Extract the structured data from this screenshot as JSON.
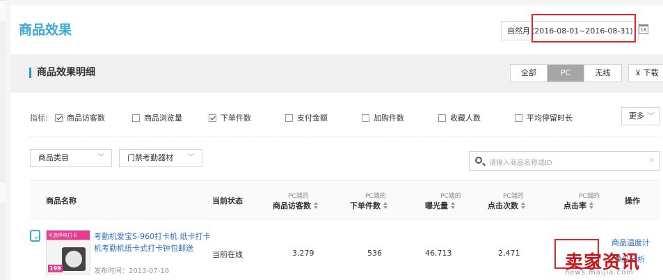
{
  "header": {
    "title": "商品效果",
    "date_mode": "自然月",
    "date_range": "(2016-08-01~2016-08-31)",
    "calendar_icon": "calendar-icon",
    "calendar_day": "18"
  },
  "section": {
    "title": "商品效果明细",
    "segments": [
      "全部",
      "PC",
      "无线"
    ],
    "active_segment": "PC",
    "download_label": "下载"
  },
  "metrics": {
    "prefix": "指标:",
    "items": [
      {
        "label": "商品访客数",
        "checked": true
      },
      {
        "label": "商品浏览量",
        "checked": false
      },
      {
        "label": "下单件数",
        "checked": true
      },
      {
        "label": "支付金额",
        "checked": false
      },
      {
        "label": "加购件数",
        "checked": false
      },
      {
        "label": "收藏人数",
        "checked": false
      },
      {
        "label": "平均停留时长",
        "checked": false
      }
    ],
    "more_label": "更多"
  },
  "filters": {
    "category": "商品类目",
    "subcategory": "门禁考勤器材",
    "search_placeholder": "请输入商品名称或ID"
  },
  "table": {
    "columns": {
      "name": "商品名称",
      "status": "当前状态",
      "visitors": {
        "pre": "PC端的",
        "main": "商品访客数"
      },
      "orders": {
        "pre": "PC端的",
        "main": "下单件数"
      },
      "exposure": {
        "pre": "PC端的",
        "main": "曝光量"
      },
      "clicks": {
        "pre": "PC端的",
        "main": "点击次数"
      },
      "ctr": {
        "pre": "PC端的",
        "main": "点击率"
      },
      "actions": "操作"
    },
    "rows": [
      {
        "title": "考勤机爱宝S-960打卡机 纸卡打卡机考勤机纸卡式打卡钟包邮送",
        "published": "发布时间：2013-07-16",
        "status": "当前在线",
        "visitors": "3,279",
        "orders": "536",
        "exposure": "46,713",
        "clicks": "2,471",
        "action_1": "商品温度计",
        "action_2": "单品分析",
        "thumb_banner": "可选停电打卡",
        "thumb_price": "199"
      }
    ]
  },
  "watermark": {
    "main": "卖家资讯",
    "sub": "news.maijia.com"
  },
  "colors": {
    "accent": "#3aa9d8",
    "link": "#2b6fc7",
    "highlight": "#e3262a",
    "watermark": "#c6171c"
  }
}
